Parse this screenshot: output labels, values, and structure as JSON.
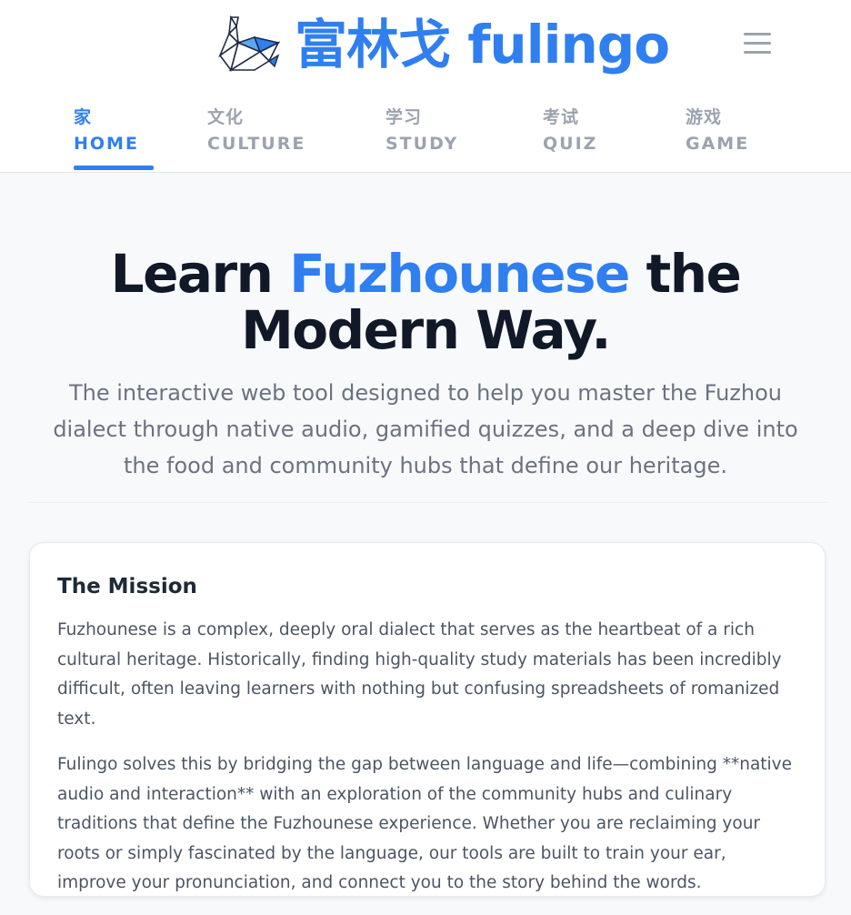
{
  "brand": {
    "logo_icon": "origami-swan-icon",
    "name": "富林戈 fulingo",
    "accent_color": "#2f7ff0"
  },
  "menu": {
    "icon": "hamburger-menu-icon"
  },
  "nav": {
    "tabs": [
      {
        "zh": "家",
        "en": "HOME",
        "active": true
      },
      {
        "zh": "文化",
        "en": "CULTURE",
        "active": false
      },
      {
        "zh": "学习",
        "en": "STUDY",
        "active": false
      },
      {
        "zh": "考试",
        "en": "QUIZ",
        "active": false
      },
      {
        "zh": "游戏",
        "en": "GAME",
        "active": false
      }
    ]
  },
  "hero": {
    "title_pre": "Learn ",
    "title_highlight": "Fuzhounese",
    "title_post": " the Modern Way.",
    "subtitle": "The interactive web tool designed to help you master the Fuzhou dialect through native audio, gamified quizzes, and a deep dive into the food and community hubs that define our heritage."
  },
  "mission": {
    "heading": "The Mission",
    "paragraphs": [
      "Fuzhounese is a complex, deeply oral dialect that serves as the heartbeat of a rich cultural heritage. Historically, finding high-quality study materials has been incredibly difficult, often leaving learners with nothing but confusing spreadsheets of romanized text.",
      "Fulingo solves this by bridging the gap between language and life—combining **native audio and interaction** with an exploration of the community hubs and culinary traditions that define the Fuzhounese experience. Whether you are reclaiming your roots or simply fascinated by the language, our tools are built to train your ear, improve your pronunciation, and connect you to the story behind the words."
    ]
  }
}
